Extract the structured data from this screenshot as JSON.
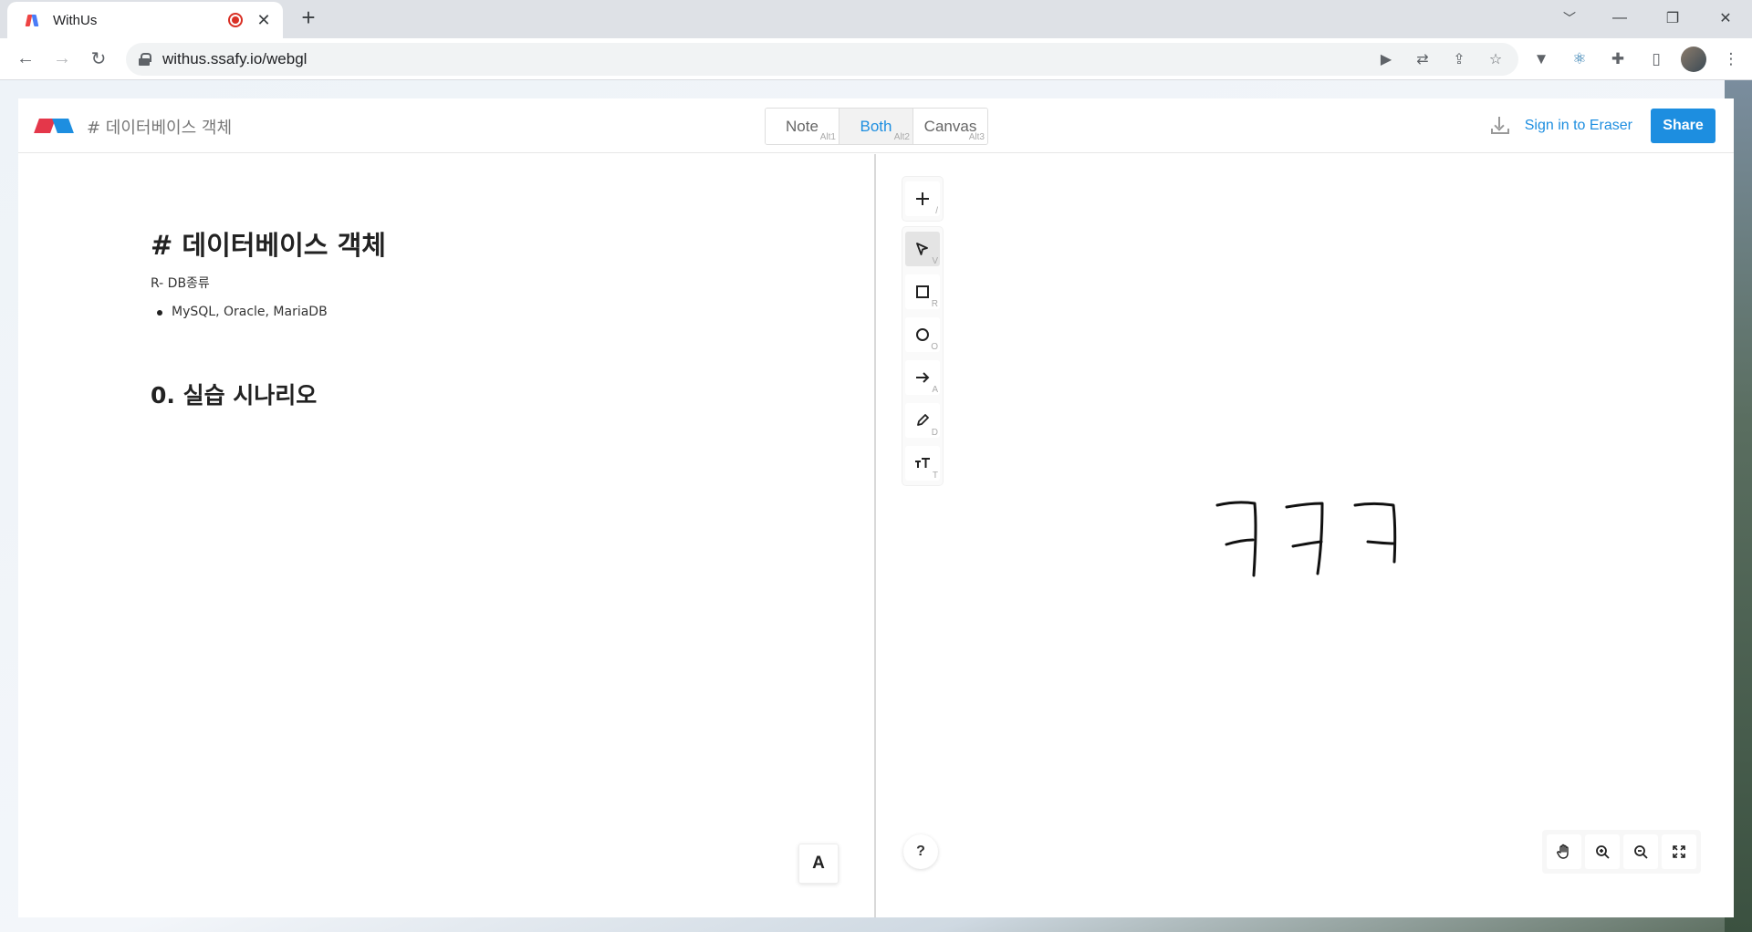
{
  "browser": {
    "tab_title": "WithUs",
    "url": "withus.ssafy.io/webgl"
  },
  "app": {
    "doc_title": "# 데이터베이스 객체",
    "view_modes": [
      {
        "label": "Note",
        "hint": "Alt1",
        "active": false
      },
      {
        "label": "Both",
        "hint": "Alt2",
        "active": true
      },
      {
        "label": "Canvas",
        "hint": "Alt3",
        "active": false
      }
    ],
    "sign_in_label": "Sign in to Eraser",
    "share_label": "Share",
    "accent_color": "#1d8ee0"
  },
  "note": {
    "heading": "# 데이터베이스 객체",
    "paragraph": "R- DB종류",
    "bullets": [
      "MySQL, Oracle, MariaDB"
    ],
    "subheading": "0. 실습 시나리오",
    "font_button_label": "A"
  },
  "canvas": {
    "add_key": "/",
    "tools": [
      {
        "name": "select",
        "key": "V",
        "active": true
      },
      {
        "name": "rectangle",
        "key": "R",
        "active": false
      },
      {
        "name": "ellipse",
        "key": "O",
        "active": false
      },
      {
        "name": "arrow",
        "key": "A",
        "active": false
      },
      {
        "name": "draw",
        "key": "D",
        "active": false
      },
      {
        "name": "text",
        "key": "T",
        "active": false
      }
    ],
    "help_label": "?",
    "drawing_text": "ㅋㅋㅋ"
  }
}
